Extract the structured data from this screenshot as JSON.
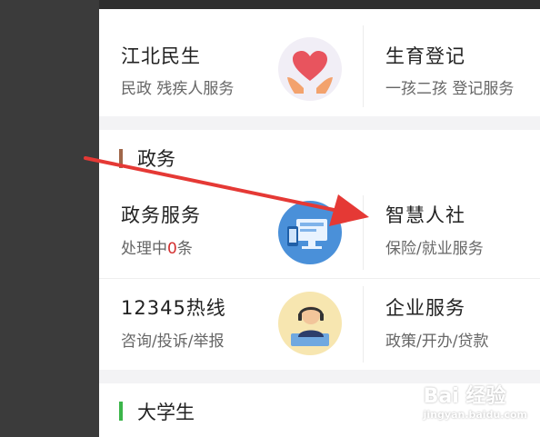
{
  "sections": {
    "livelihood": {
      "tiles": [
        {
          "title": "江北民生",
          "subtitle": "民政 残疾人服务",
          "icon": "heart-hands-icon"
        },
        {
          "title": "生育登记",
          "subtitle": "一孩二孩 登记服务",
          "icon": "none"
        }
      ]
    },
    "government": {
      "heading": "政务",
      "accent": "#a0674a",
      "tiles": [
        {
          "title": "政务服务",
          "subtitle_prefix": "处理中",
          "subtitle_count": "0",
          "subtitle_suffix": "条",
          "icon": "computer-monitor-icon"
        },
        {
          "title": "智慧人社",
          "subtitle": "保险/就业服务",
          "icon": "none"
        },
        {
          "title": "12345热线",
          "subtitle": "咨询/投诉/举报",
          "icon": "hotline-operator-icon"
        },
        {
          "title": "企业服务",
          "subtitle": "政策/开办/贷款",
          "icon": "none"
        }
      ]
    },
    "students": {
      "heading": "大学生",
      "accent": "#3bb54a"
    }
  },
  "watermark": {
    "main": "Bai 经验",
    "sub": "jingyan.baidu.com"
  },
  "colors": {
    "count_red": "#d32f2f",
    "arrow_red": "#e53935"
  }
}
